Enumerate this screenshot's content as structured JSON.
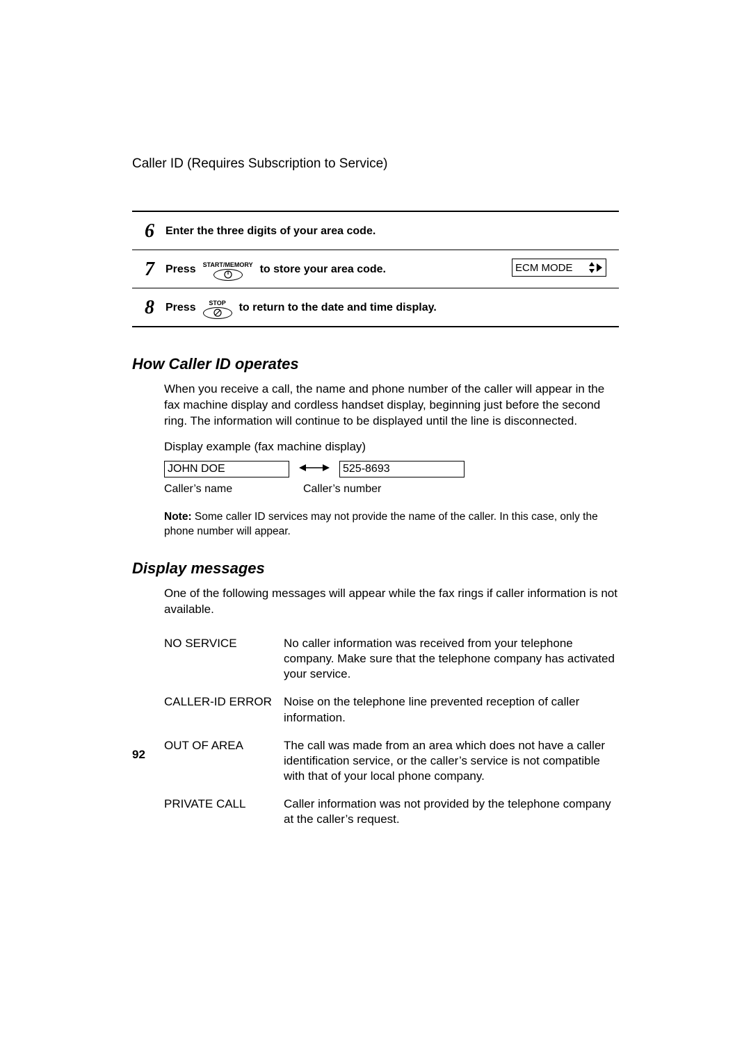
{
  "header": "Caller ID (Requires Subscription to Service)",
  "steps": [
    {
      "num": "6",
      "pre": "",
      "btn": null,
      "post": "Enter the three digits of your area code.",
      "lcd": null
    },
    {
      "num": "7",
      "pre": "Press",
      "btn": {
        "label": "START/MEMORY",
        "icon": "pwr"
      },
      "post": "to store your area code.",
      "lcd": "ECM MODE"
    },
    {
      "num": "8",
      "pre": "Press",
      "btn": {
        "label": "STOP",
        "icon": "stop"
      },
      "post": "to return to the date and time display.",
      "lcd": null
    }
  ],
  "section1": {
    "title": "How Caller ID operates",
    "para": "When you receive a call, the name and phone number of the caller will appear in the fax machine display and cordless handset display, beginning just before the second ring. The information will continue to be displayed until the line is disconnected.",
    "example_label": "Display example (fax machine display)",
    "caller_name": "JOHN DOE",
    "caller_number": "525-8693",
    "caption_name": "Caller’s name",
    "caption_number": "Caller’s number",
    "note_label": "Note:",
    "note_body": " Some caller ID services may not provide the name of the caller. In this case, only the phone number will appear."
  },
  "section2": {
    "title": "Display messages",
    "intro": "One of the following messages will appear while the fax rings if caller information is not available.",
    "rows": [
      {
        "label": "NO SERVICE",
        "desc": "No caller information was received from your telephone company. Make sure that the telephone company has activated your service."
      },
      {
        "label": "CALLER-ID ERROR",
        "desc": "Noise on the telephone line prevented reception of caller information."
      },
      {
        "label": "OUT OF AREA",
        "desc": "The call was made from an area which does not have a caller identification service, or the caller’s service is not compatible with that of your local phone company."
      },
      {
        "label": "PRIVATE CALL",
        "desc": "Caller information was not provided by the telephone company at the caller’s request."
      }
    ]
  },
  "page_number": "92"
}
